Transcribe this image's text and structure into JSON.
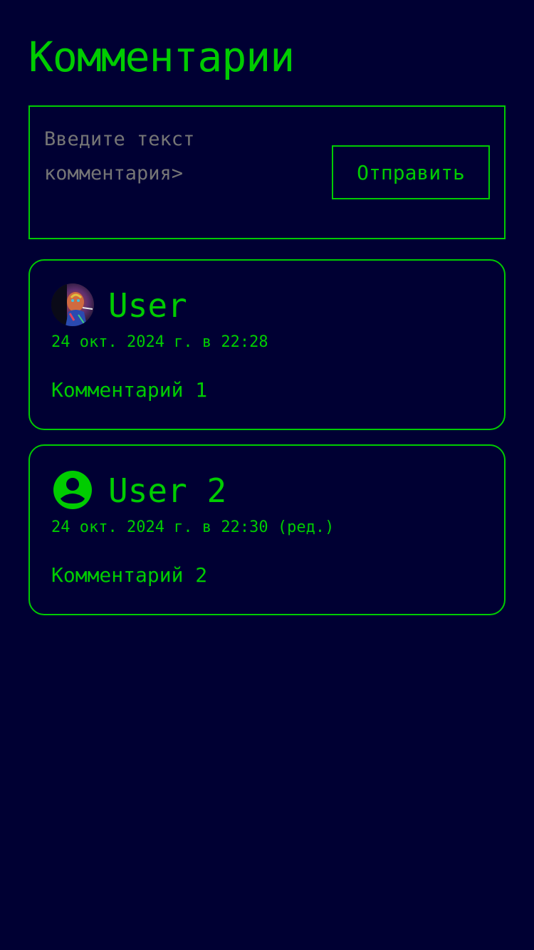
{
  "header": {
    "title": "Комментарии"
  },
  "composer": {
    "input_placeholder": "Введите текст комментария>",
    "send_label": "Отправить"
  },
  "comments": [
    {
      "user": "User",
      "timestamp": "24 окт. 2024 г. в 22:28",
      "text": "Комментарий 1",
      "avatar": "user-photo-avatar"
    },
    {
      "user": "User 2",
      "timestamp": "24 окт. 2024 г. в 22:30 (ред.)",
      "text": "Комментарий 2",
      "avatar": "default-user-icon"
    }
  ],
  "colors": {
    "background": "#000033",
    "accent": "#00cc00"
  }
}
